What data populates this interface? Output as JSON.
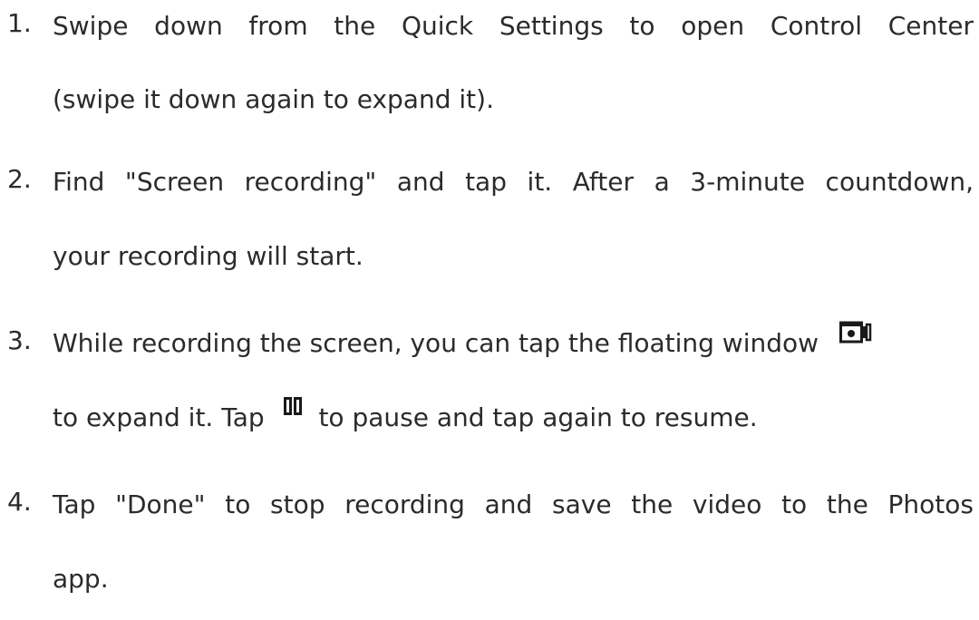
{
  "steps": [
    {
      "number": "1.",
      "line1": "Swipe down from the Quick Settings to open Control Center",
      "line2": "(swipe it down again to expand it)."
    },
    {
      "number": "2.",
      "line1": "Find \"Screen recording\" and tap it. After a 3-minute countdown,",
      "line2": "your recording will start."
    },
    {
      "number": "3.",
      "line1_before_icon": "While recording the screen, you can tap the floating window",
      "line2_before_icon": "to expand it. Tap",
      "line2_after_icon": "to pause and tap again to resume.",
      "icons": [
        "screen-recording-window-icon",
        "pause-icon"
      ]
    },
    {
      "number": "4.",
      "line1": "Tap \"Done\" to stop recording and save the video to the Photos",
      "line2": "app."
    }
  ]
}
